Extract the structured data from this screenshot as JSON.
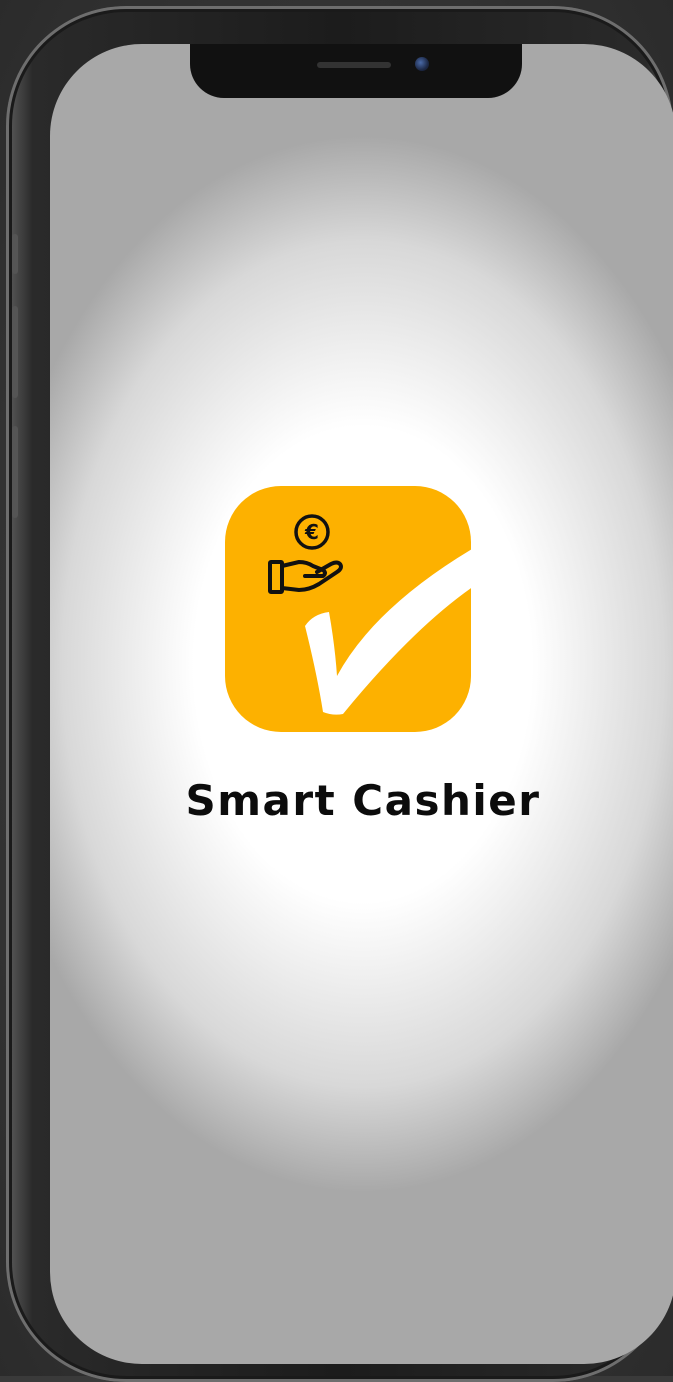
{
  "app": {
    "name": "Smart Cashier",
    "icon": "smart-cashier-app-icon",
    "icon_glyphs": {
      "coin": "euro-coin-icon",
      "hand": "open-hand-icon",
      "check": "checkmark-icon"
    },
    "colors": {
      "icon_background": "#fdb100",
      "icon_foreground": "#111111",
      "checkmark": "#ffffff"
    }
  },
  "device": {
    "frame": "phone-frame",
    "notch": "notch",
    "camera": "front-camera"
  },
  "coin_symbol": "€"
}
